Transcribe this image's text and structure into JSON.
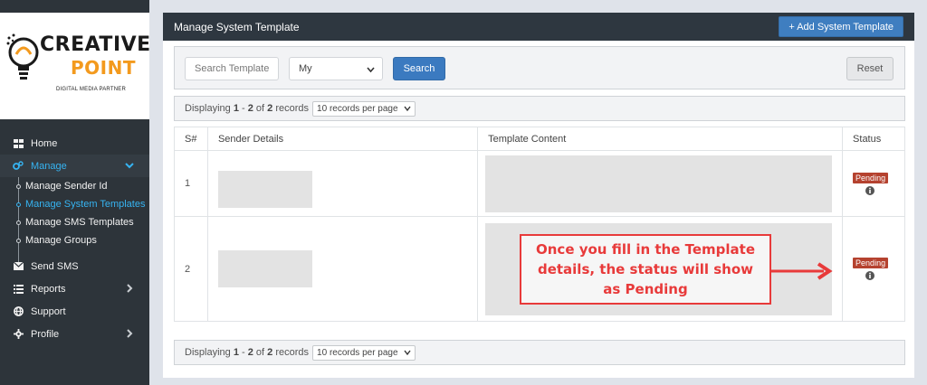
{
  "brand": {
    "name_line1": "CREATIVE",
    "name_line2": "POINT",
    "tagline": "DIGITAL MEDIA PARTNER",
    "accent": "#f39a1e"
  },
  "sidebar": {
    "items": [
      {
        "label": "Home",
        "icon": "grid-icon"
      },
      {
        "label": "Manage",
        "icon": "gears-icon",
        "active": true
      },
      {
        "label": "Send SMS",
        "icon": "envelope-icon"
      },
      {
        "label": "Reports",
        "icon": "list-icon"
      },
      {
        "label": "Support",
        "icon": "globe-icon"
      },
      {
        "label": "Profile",
        "icon": "gear-icon"
      }
    ],
    "sub_items": [
      {
        "label": "Manage Sender Id"
      },
      {
        "label": "Manage System Templates",
        "current": true
      },
      {
        "label": "Manage SMS Templates"
      },
      {
        "label": "Manage Groups"
      }
    ]
  },
  "panel": {
    "title": "Manage System Template",
    "add_button": "+ Add System Template"
  },
  "filter": {
    "search_placeholder": "Search Template",
    "select_value": "My",
    "search_button": "Search",
    "reset_button": "Reset"
  },
  "pagination": {
    "prefix": "Displaying",
    "from": "1",
    "sep": "-",
    "to": "2",
    "of": "of",
    "total": "2",
    "suffix": "records",
    "per_page": "10 records per page"
  },
  "table": {
    "headers": [
      "S#",
      "Sender Details",
      "Template Content",
      "Status"
    ],
    "rows": [
      {
        "sn": "1",
        "status": "Pending"
      },
      {
        "sn": "2",
        "status": "Pending"
      }
    ]
  },
  "callout": {
    "text": "Once you fill in the Template details, the status will show as Pending",
    "color": "#e83a3a"
  },
  "colors": {
    "sidebar_bg": "#2d343a",
    "header_bg": "#2e3740",
    "primary": "#3b7ac0",
    "active_link": "#36b4f2",
    "badge_red": "#b5422f"
  }
}
